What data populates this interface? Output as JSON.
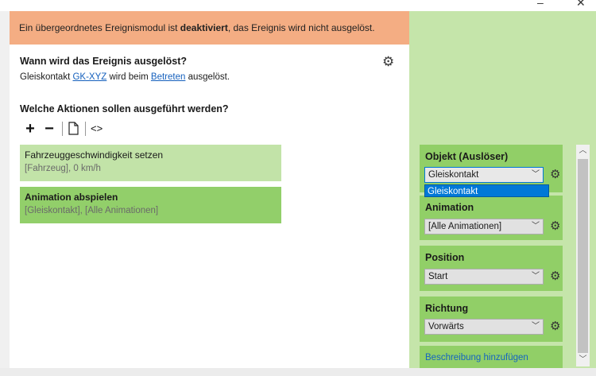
{
  "window": {
    "minimize_glyph": "–",
    "close_glyph": "✕"
  },
  "warning": {
    "prefix": "Ein übergeordnetes Ereignismodul ist ",
    "emphasis": "deaktiviert",
    "suffix": ", das Ereignis wird nicht ausgelöst.",
    "background": "#f4ad83"
  },
  "trigger": {
    "heading": "Wann wird das Ereignis ausgelöst?",
    "text_before": "Gleiskontakt ",
    "link1": "GK-XYZ",
    "text_middle": " wird beim ",
    "link2": "Betreten",
    "text_after": " ausgelöst."
  },
  "actions_section": {
    "heading": "Welche Aktionen sollen ausgeführt werden?",
    "toolbar": {
      "add": "+",
      "remove": "−",
      "copy_icon": "copy-icon",
      "code": "<>"
    },
    "items": [
      {
        "title": "Fahrzeuggeschwindigkeit setzen",
        "subtitle": "[Fahrzeug], 0 km/h"
      },
      {
        "title": "Animation abspielen",
        "subtitle": "[Gleiskontakt], [Alle Animationen]"
      }
    ]
  },
  "properties": {
    "panels": [
      {
        "label": "Objekt (Auslöser)",
        "value": "Gleiskontakt"
      },
      {
        "label": "Animation",
        "value": "[Alle Animationen]"
      },
      {
        "label": "Position",
        "value": "Start"
      },
      {
        "label": "Richtung",
        "value": "Vorwärts"
      }
    ],
    "dropdown_option": "Gleiskontakt",
    "description_link": "Beschreibung hinzufügen"
  },
  "colors": {
    "panel_bg": "#c5e5aa",
    "panel_card": "#91cf67",
    "action_light": "#c2e3a8",
    "action_selected": "#92cf6a",
    "link": "#1560bd",
    "selection": "#0078d7"
  }
}
